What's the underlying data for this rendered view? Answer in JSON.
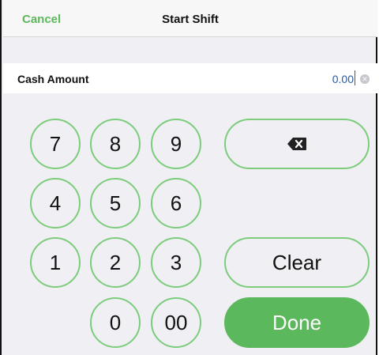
{
  "navbar": {
    "cancel_label": "Cancel",
    "title": "Start Shift"
  },
  "cash_row": {
    "label": "Cash Amount",
    "value": "0.00",
    "clear_icon": "clear-circle-icon"
  },
  "keypad": {
    "keys": [
      "7",
      "8",
      "9",
      "4",
      "5",
      "6",
      "1",
      "2",
      "3",
      "0",
      "00"
    ],
    "backspace_icon": "backspace-icon",
    "clear_label": "Clear",
    "done_label": "Done"
  },
  "colors": {
    "accent": "#5cb85c",
    "key_border": "#7ccc7c",
    "value_text": "#2c5aa0"
  }
}
